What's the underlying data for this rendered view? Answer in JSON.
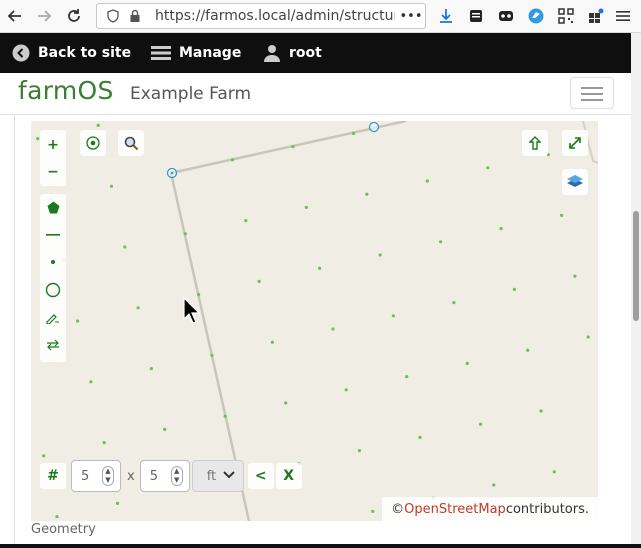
{
  "browser": {
    "url": "https://farmos.local/admin/structure/",
    "back_icon": "arrow-left-icon",
    "forward_icon": "arrow-right-icon",
    "reload_icon": "reload-icon",
    "more_icon": "ellipsis-icon"
  },
  "admin_toolbar": {
    "back_to_site": "Back to site",
    "manage": "Manage",
    "user": "root"
  },
  "site": {
    "brand": "farmOS",
    "name": "Example Farm"
  },
  "map": {
    "zoom_in": "+",
    "zoom_out": "−",
    "geolocate_icon": "target-icon",
    "geocode_icon": "magnifier-icon",
    "export_icon": "upload-arrow-icon",
    "fullscreen_icon": "expand-icon",
    "layers_icon": "layers-icon",
    "draw_tools": [
      "polygon-tool",
      "line-tool",
      "point-tool",
      "circle-tool",
      "modify-tool",
      "translate-tool"
    ],
    "grid": {
      "hash_label": "#",
      "x_value": "5",
      "x_sep": "x",
      "y_value": "5",
      "unit": "ft",
      "prev_label": "<",
      "close_label": "X"
    },
    "attribution_prefix": "© ",
    "attribution_link": "OpenStreetMap",
    "attribution_suffix": " contributors."
  },
  "field_label": "Geometry",
  "colors": {
    "brand_green": "#3a7d33",
    "map_green": "#1b7a1b",
    "grid_point": "#6cc05a",
    "vertex_blue": "#3399cc",
    "admin_bg": "#0f0f0f"
  }
}
